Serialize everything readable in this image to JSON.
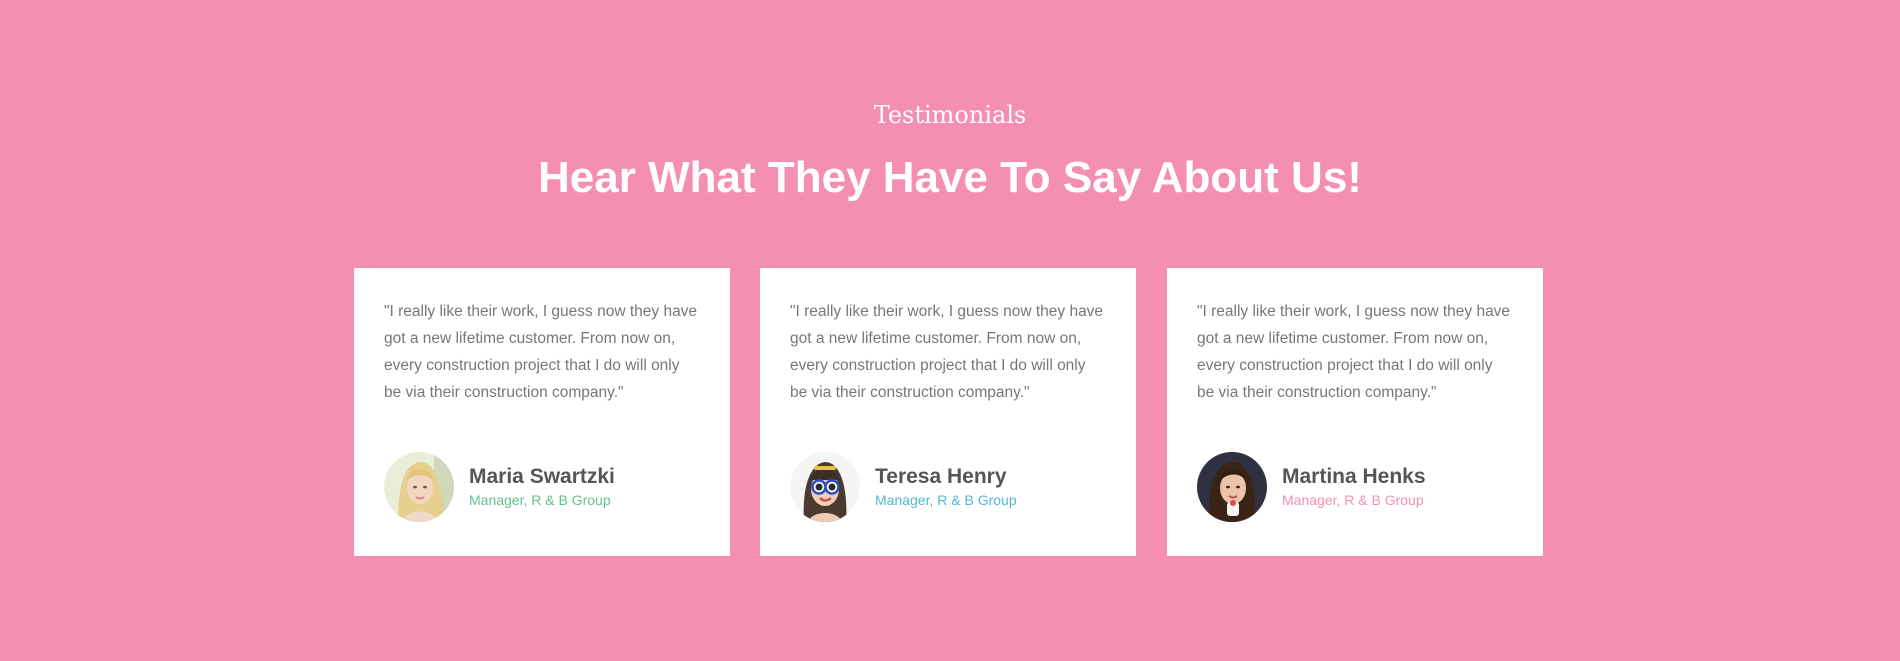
{
  "section": {
    "eyebrow": "Testimonials",
    "title": "Hear What They Have To Say About Us!",
    "background_color": "#f48fb1"
  },
  "testimonials": [
    {
      "quote": "\"I really like their work, I guess now they have got a new lifetime customer. From now on, every construction project that I do will only be via their construction company.\"",
      "name": "Maria Swartzki",
      "role": "Manager, R & B Group",
      "role_color": "#66c28a",
      "avatar_icon": "avatar-blonde-woman"
    },
    {
      "quote": "\"I really like their work, I guess now they have got a new lifetime customer. From now on, every construction project that I do will only be via their construction company.\"",
      "name": "Teresa Henry",
      "role": "Manager, R & B Group",
      "role_color": "#4fb8d8",
      "avatar_icon": "avatar-woman-sunglasses"
    },
    {
      "quote": "\"I really like their work, I guess now they have got a new lifetime customer. From now on, every construction project that I do will only be via their construction company.\"",
      "name": "Martina Henks",
      "role": "Manager, R & B Group",
      "role_color": "#f48fb1",
      "avatar_icon": "avatar-brunette-woman"
    }
  ]
}
